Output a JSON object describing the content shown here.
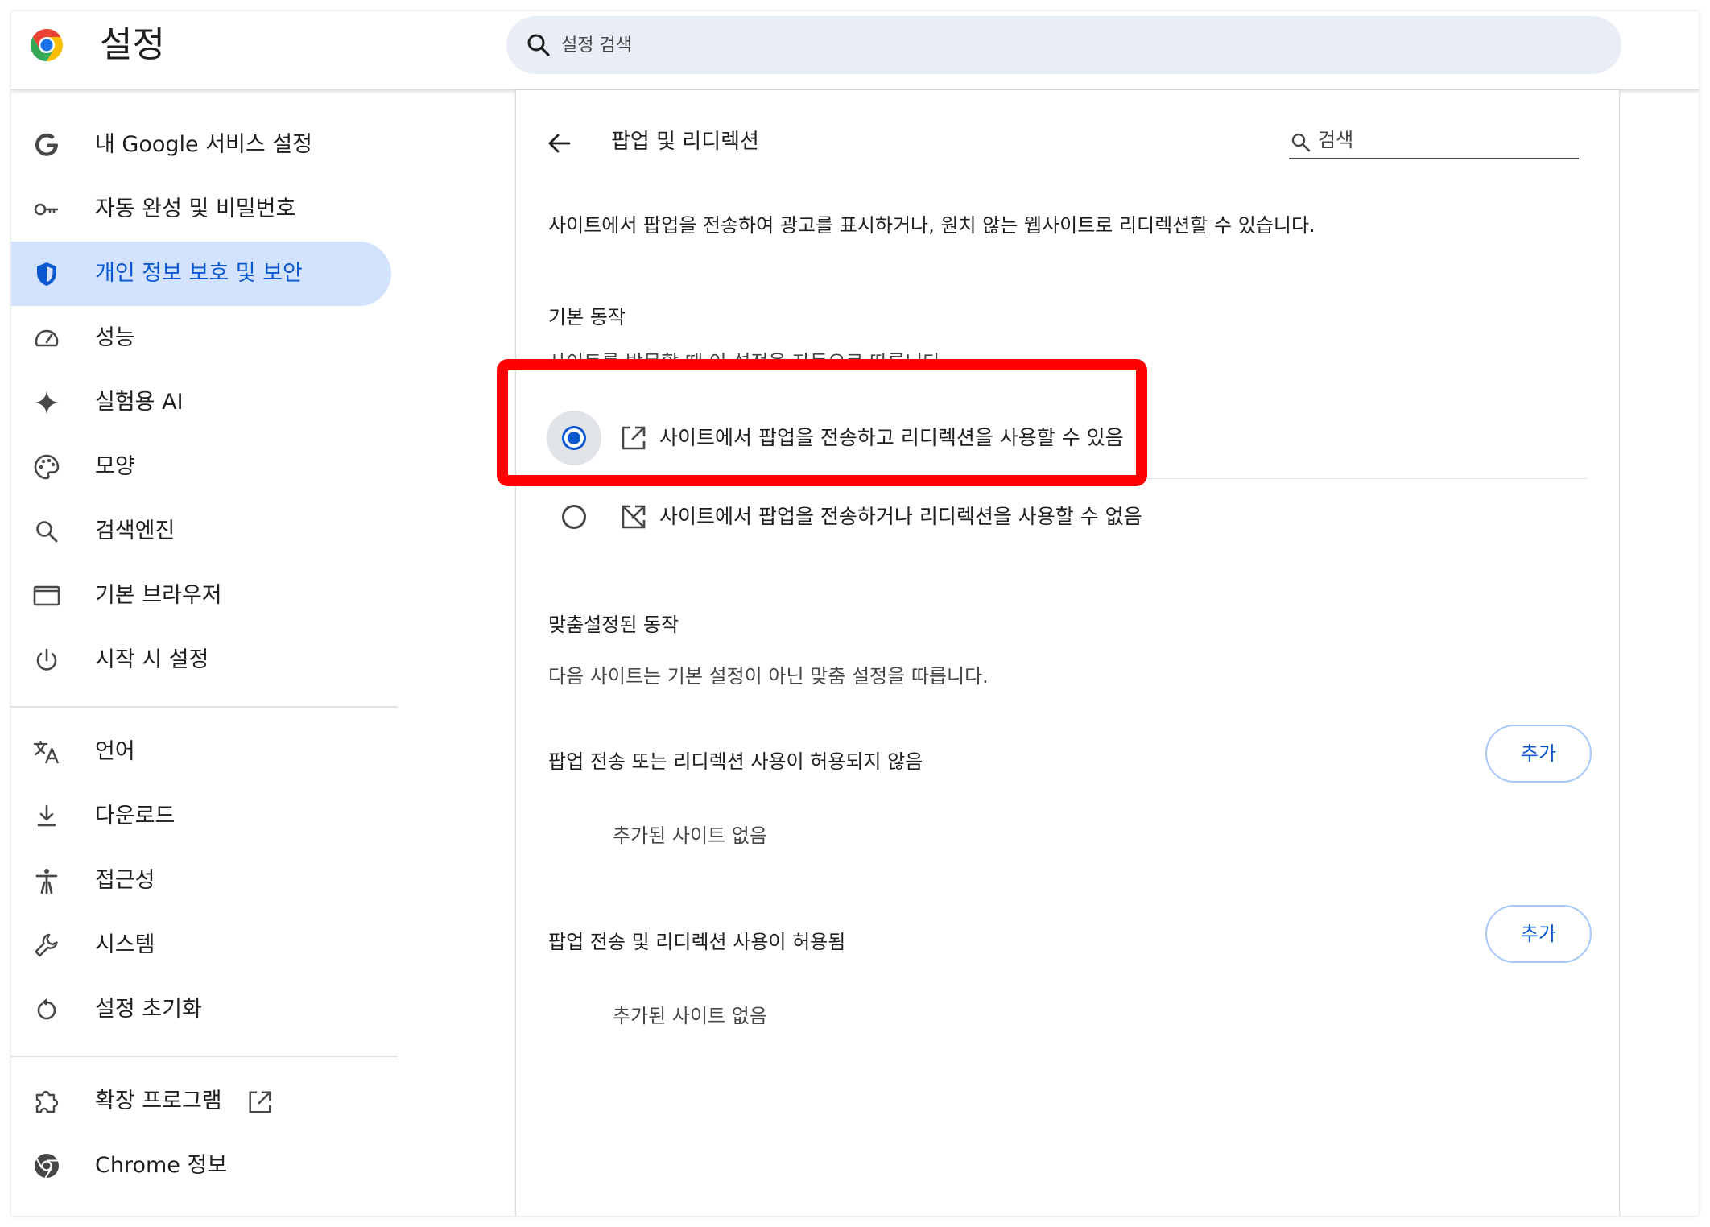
{
  "header": {
    "title": "설정",
    "search_placeholder": "설정 검색"
  },
  "sidebar": {
    "items": [
      {
        "label": "내 Google 서비스 설정",
        "icon": "google-g-icon"
      },
      {
        "label": "자동 완성 및 비밀번호",
        "icon": "key-icon"
      },
      {
        "label": "개인 정보 보호 및 보안",
        "icon": "shield-icon",
        "active": true
      },
      {
        "label": "성능",
        "icon": "speedometer-icon"
      },
      {
        "label": "실험용 AI",
        "icon": "sparkle-icon"
      },
      {
        "label": "모양",
        "icon": "palette-icon"
      },
      {
        "label": "검색엔진",
        "icon": "search-icon"
      },
      {
        "label": "기본 브라우저",
        "icon": "browser-window-icon"
      },
      {
        "label": "시작 시 설정",
        "icon": "power-icon"
      },
      {
        "label": "언어",
        "icon": "translate-icon"
      },
      {
        "label": "다운로드",
        "icon": "download-icon"
      },
      {
        "label": "접근성",
        "icon": "accessibility-icon"
      },
      {
        "label": "시스템",
        "icon": "wrench-icon"
      },
      {
        "label": "설정 초기화",
        "icon": "reset-icon"
      },
      {
        "label": "확장 프로그램",
        "icon": "puzzle-icon"
      },
      {
        "label": "Chrome 정보",
        "icon": "chrome-icon"
      }
    ]
  },
  "content": {
    "title": "팝업 및 리디렉션",
    "search_placeholder": "검색",
    "description": "사이트에서 팝업을 전송하여 광고를 표시하거나, 원치 않는 웹사이트로 리디렉션할 수 있습니다.",
    "default_behavior": {
      "heading": "기본 동작",
      "subtext": "사이트를 방문할 때 이 설정을 자동으로 따릅니다.",
      "options": [
        {
          "label": "사이트에서 팝업을 전송하고 리디렉션을 사용할 수 있음",
          "checked": true,
          "icon": "open-in-new-icon"
        },
        {
          "label": "사이트에서 팝업을 전송하거나 리디렉션을 사용할 수 없음",
          "checked": false,
          "icon": "popup-blocked-icon"
        }
      ]
    },
    "custom_behavior": {
      "heading": "맞춤설정된 동작",
      "subtext": "다음 사이트는 기본 설정이 아닌 맞춤 설정을 따릅니다.",
      "blocked": {
        "label": "팝업 전송 또는 리디렉션 사용이 허용되지 않음",
        "add_label": "추가",
        "empty": "추가된 사이트 없음"
      },
      "allowed": {
        "label": "팝업 전송 및 리디렉션 사용이 허용됨",
        "add_label": "추가",
        "empty": "추가된 사이트 없음"
      }
    }
  },
  "colors": {
    "accent": "#0b57d0",
    "active_nav_bg": "#d3e3fd",
    "search_bg": "#e9eef6",
    "highlight": "#ff0000"
  }
}
